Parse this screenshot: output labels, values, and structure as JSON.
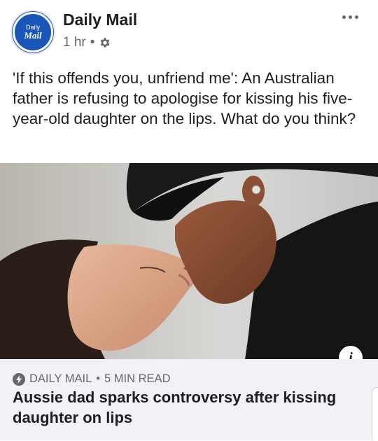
{
  "post": {
    "page_name": "Daily Mail",
    "avatar_text_line1": "Daily",
    "avatar_text_line2": "Mail",
    "time": "1 hr",
    "separator": "•",
    "privacy_icon": "gear-icon",
    "more_icon": "more-options-icon",
    "text": "'If this offends you, unfriend me': An Australian father is refusing to apologise for kissing his five-year-old daughter on the lips. What do you think?"
  },
  "link_preview": {
    "source_icon": "instant-article-bolt-icon",
    "source": "DAILY MAIL",
    "separator": "•",
    "read_time": "5 MIN READ",
    "headline": "Aussie dad sparks controversy after kissing daughter on lips",
    "info_icon_label": "i"
  },
  "colors": {
    "brand_blue": "#1a56b8",
    "secondary_text": "#65676b",
    "link_box_bg": "#f0f2f5"
  }
}
